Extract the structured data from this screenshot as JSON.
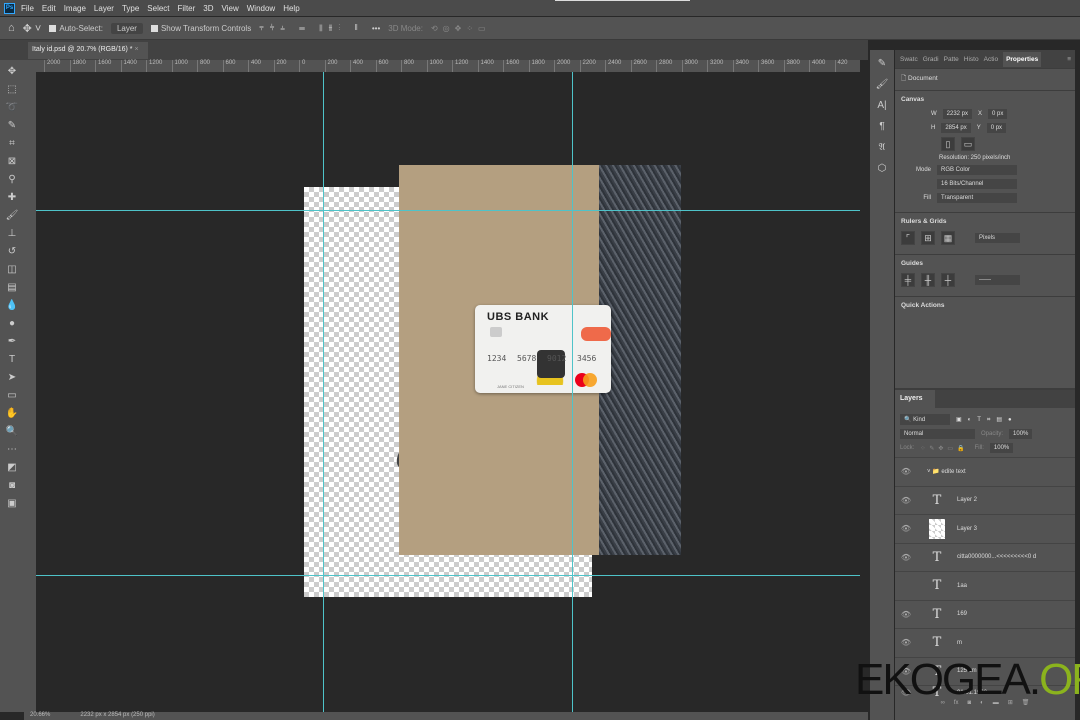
{
  "app": {
    "logo": "Ps"
  },
  "menu": [
    "File",
    "Edit",
    "Image",
    "Layer",
    "Type",
    "Select",
    "Filter",
    "3D",
    "View",
    "Window",
    "Help"
  ],
  "options": {
    "auto_select_label": "Auto-Select:",
    "auto_select_value": "Layer",
    "show_transform": "Show Transform Controls",
    "more": "•••",
    "mode_3d": "3D Mode:"
  },
  "document_tab": {
    "title": "Italy id.psd @ 20.7% (RGB/16) *",
    "close": "×"
  },
  "ruler_ticks": [
    "2000",
    "1800",
    "1600",
    "1400",
    "1200",
    "1000",
    "800",
    "600",
    "400",
    "200",
    "0",
    "200",
    "400",
    "600",
    "800",
    "1000",
    "1200",
    "1400",
    "1600",
    "1800",
    "2000",
    "2200",
    "2400",
    "2600",
    "2800",
    "3000",
    "3200",
    "3400",
    "3600",
    "3800",
    "4000",
    "420"
  ],
  "card": {
    "bank": "UBS BANK",
    "numbers": [
      "1234",
      "5678",
      "9012",
      "3456"
    ],
    "holder": "JANE CITIZEN"
  },
  "canvas_letter": "e",
  "status": {
    "zoom": "20.66%",
    "doc_info": "2232 px x 2854 px (250 ppi)"
  },
  "panel_tabs": [
    "Swatc",
    "Gradi",
    "Patte",
    "Histo",
    "Actio",
    "Properties"
  ],
  "properties": {
    "document_label": "Document",
    "canvas_header": "Canvas",
    "w_label": "W",
    "w_value": "2232 px",
    "x_label": "X",
    "x_value": "0 px",
    "h_label": "H",
    "h_value": "2854 px",
    "y_label": "Y",
    "y_value": "0 px",
    "resolution": "Resolution: 250 pixels/inch",
    "mode_label": "Mode",
    "mode_value": "RGB Color",
    "depth_value": "16 Bits/Channel",
    "fill_label": "Fill",
    "fill_value": "Transparent",
    "rulers_header": "Rulers & Grids",
    "units_value": "Pixels",
    "guides_header": "Guides",
    "quick_actions_header": "Quick Actions"
  },
  "layers": {
    "title": "Layers",
    "filter": "Kind",
    "blend": "Normal",
    "opacity_label": "Opacity:",
    "opacity_value": "100%",
    "lock_label": "Lock:",
    "fill_label": "Fill:",
    "fill_value": "100%",
    "items": [
      {
        "name": "edite text",
        "type": "group"
      },
      {
        "name": "Layer 2",
        "type": "text"
      },
      {
        "name": "Layer 3",
        "type": "image"
      },
      {
        "name": "citta0000000...<<<<<<<<<0 d",
        "type": "text"
      },
      {
        "name": "1aa",
        "type": "text",
        "hidden": true
      },
      {
        "name": "169",
        "type": "text"
      },
      {
        "name": "m",
        "type": "text"
      },
      {
        "name": "125 cm",
        "type": "text"
      },
      {
        "name": "01.01.1990",
        "type": "text"
      }
    ]
  },
  "watermark": {
    "main": "EKOGEA.",
    "accent": "ORG"
  },
  "colors": {
    "guide": "#4ec3c9",
    "accent": "#31a8ff",
    "watermark_green": "#8bb31d"
  }
}
